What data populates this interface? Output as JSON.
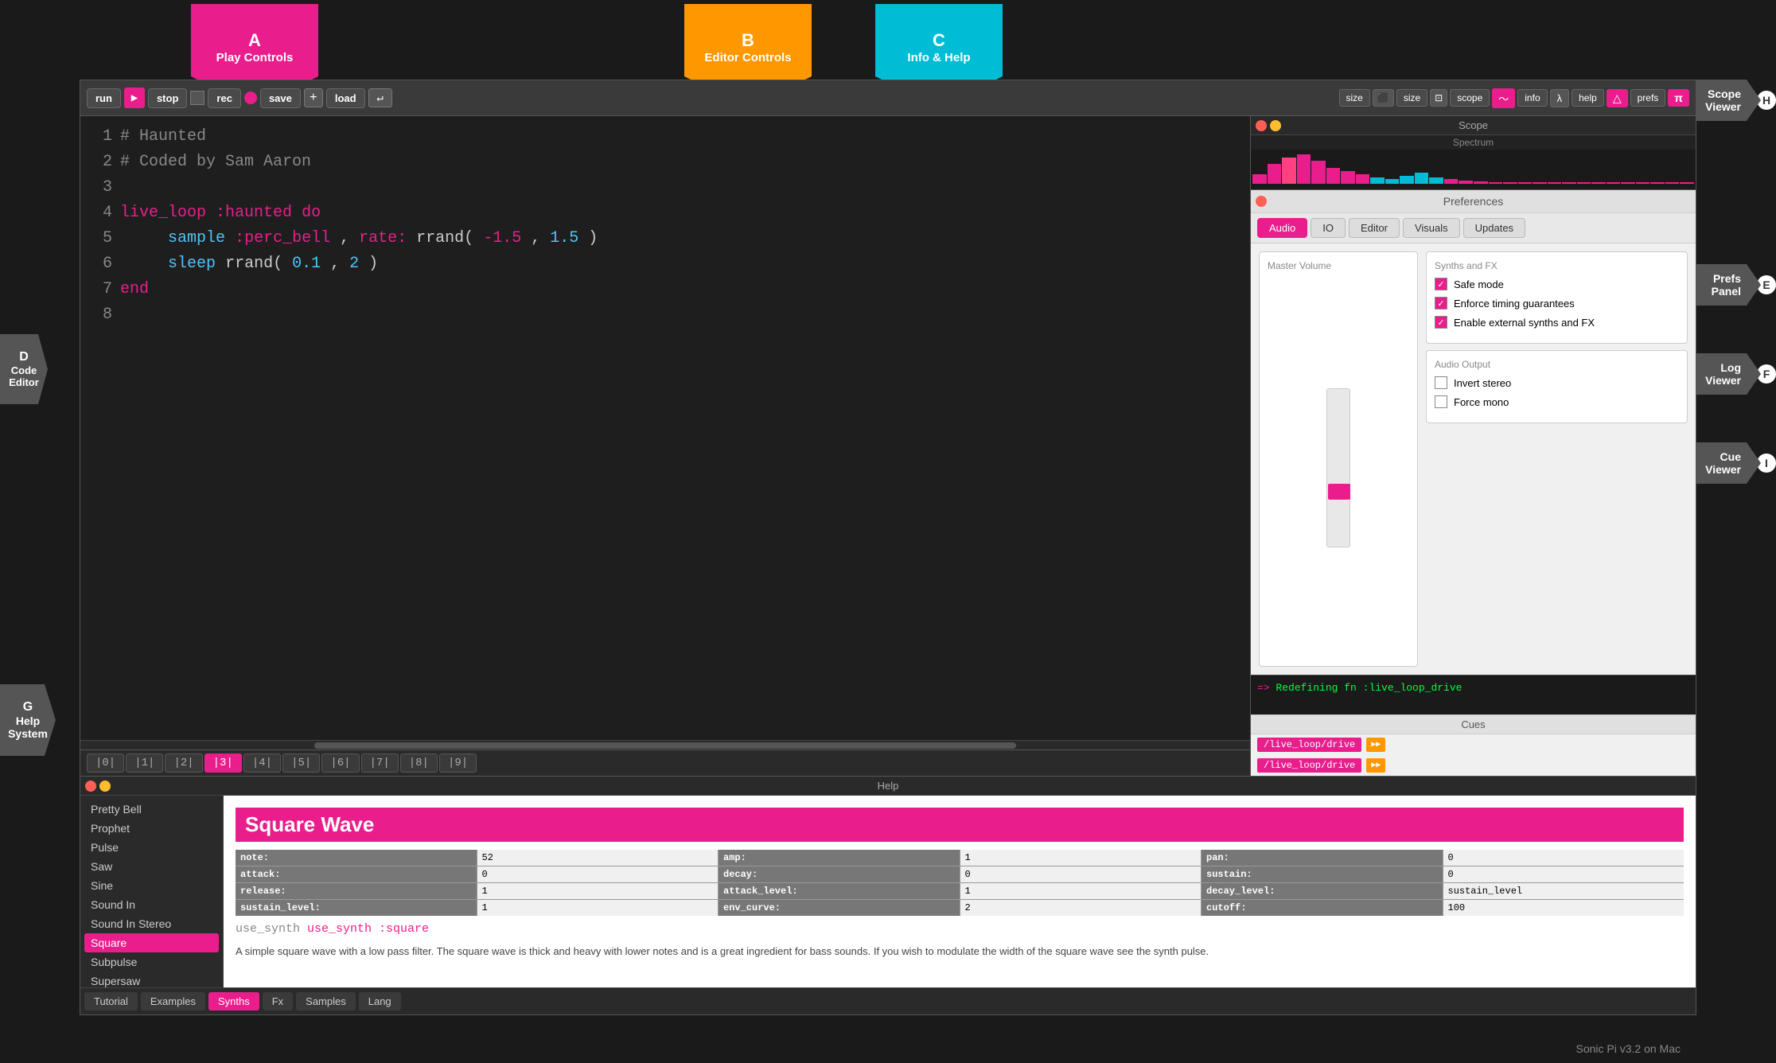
{
  "app": {
    "title": "Sonic Pi",
    "version": "Sonic Pi v3.2 on Mac"
  },
  "arrows": {
    "a": {
      "letter": "A",
      "label": "Play\nControls"
    },
    "b": {
      "letter": "B",
      "label": "Editor\nControls"
    },
    "c": {
      "letter": "C",
      "label": "Info &\nHelp"
    },
    "d": {
      "letter": "D",
      "label": "Code\nEditor"
    },
    "e": {
      "letter": "E",
      "label": "Prefs\nPanel"
    },
    "f": {
      "letter": "F",
      "label": "Log\nViewer"
    },
    "g": {
      "letter": "G",
      "label": "Help\nSystem"
    },
    "h": {
      "letter": "H",
      "label": "Scope\nViewer"
    },
    "i": {
      "letter": "I",
      "label": "Cue\nViewer"
    }
  },
  "toolbar": {
    "run_label": "run",
    "stop_label": "stop",
    "rec_label": "rec",
    "save_label": "save",
    "load_label": "load",
    "size_label": "size",
    "scope_label": "scope",
    "info_label": "info",
    "help_label": "help",
    "prefs_label": "prefs"
  },
  "code": {
    "lines": [
      {
        "num": 1,
        "text": "# Haunted",
        "type": "comment"
      },
      {
        "num": 2,
        "text": "# Coded by Sam Aaron",
        "type": "comment"
      },
      {
        "num": 3,
        "text": "",
        "type": "empty"
      },
      {
        "num": 4,
        "text": "live_loop :haunted do",
        "type": "code"
      },
      {
        "num": 5,
        "text": "  sample :perc_bell, rate: rrand(-1.5, 1.5)",
        "type": "code"
      },
      {
        "num": 6,
        "text": "  sleep rrand(0.1, 2)",
        "type": "code"
      },
      {
        "num": 7,
        "text": "end",
        "type": "code"
      },
      {
        "num": 8,
        "text": "",
        "type": "empty"
      }
    ]
  },
  "tabs": {
    "items": [
      {
        "label": "|0|",
        "active": false
      },
      {
        "label": "|1|",
        "active": false
      },
      {
        "label": "|2|",
        "active": false
      },
      {
        "label": "|3|",
        "active": true
      },
      {
        "label": "|4|",
        "active": false
      },
      {
        "label": "|5|",
        "active": false
      },
      {
        "label": "|6|",
        "active": false
      },
      {
        "label": "|7|",
        "active": false
      },
      {
        "label": "|8|",
        "active": false
      },
      {
        "label": "|9|",
        "active": false
      }
    ]
  },
  "scope": {
    "title": "Scope",
    "subtitle": "Spectrum"
  },
  "prefs": {
    "title": "Preferences",
    "tabs": [
      {
        "label": "Audio",
        "active": true
      },
      {
        "label": "IO",
        "active": false
      },
      {
        "label": "Editor",
        "active": false
      },
      {
        "label": "Visuals",
        "active": false
      },
      {
        "label": "Updates",
        "active": false
      }
    ],
    "master_volume_label": "Master Volume",
    "synths_fx_label": "Synths and FX",
    "checkboxes": [
      {
        "label": "Safe mode",
        "checked": true
      },
      {
        "label": "Enforce timing guarantees",
        "checked": true
      },
      {
        "label": "Enable external synths and FX",
        "checked": true
      }
    ],
    "audio_output_label": "Audio Output",
    "audio_output_checkboxes": [
      {
        "label": "Invert stereo",
        "checked": false
      },
      {
        "label": "Force mono",
        "checked": false
      }
    ]
  },
  "log": {
    "prompt": "=>",
    "message": "Redefining fn :live_loop_drive"
  },
  "cues": {
    "title": "Cues",
    "items": [
      {
        "label": "/live_loop/drive"
      },
      {
        "label": "/live_loop/drive"
      }
    ]
  },
  "help": {
    "title": "Help",
    "synth_name": "Square Wave",
    "use_synth": "use_synth :square",
    "description": "A simple square wave with a low pass filter. The square wave is thick and heavy with lower notes and is a great ingredient for bass sounds. If you wish to modulate the width of the square wave see the synth pulse.",
    "params": [
      {
        "label": "note:",
        "value": "52"
      },
      {
        "label": "amp:",
        "value": "1"
      },
      {
        "label": "pan:",
        "value": "0"
      },
      {
        "label": "attack:",
        "value": "0"
      },
      {
        "label": "decay:",
        "value": "0"
      },
      {
        "label": "sustain:",
        "value": "0"
      },
      {
        "label": "release:",
        "value": "1"
      },
      {
        "label": "attack_level:",
        "value": "1"
      },
      {
        "label": "decay_level:",
        "value": "sustain_level"
      },
      {
        "label": "sustain_level:",
        "value": "1"
      },
      {
        "label": "env_curve:",
        "value": "2"
      },
      {
        "label": "cutoff:",
        "value": "100"
      }
    ],
    "tabs": [
      {
        "label": "Tutorial",
        "active": false
      },
      {
        "label": "Examples",
        "active": false
      },
      {
        "label": "Synths",
        "active": true
      },
      {
        "label": "Fx",
        "active": false
      },
      {
        "label": "Samples",
        "active": false
      },
      {
        "label": "Lang",
        "active": false
      }
    ],
    "list_items": [
      "Pretty Bell",
      "Prophet",
      "Pulse",
      "Saw",
      "Sine",
      "Sound In",
      "Sound In Stereo",
      "Square",
      "Subpulse",
      "Supersaw"
    ]
  }
}
